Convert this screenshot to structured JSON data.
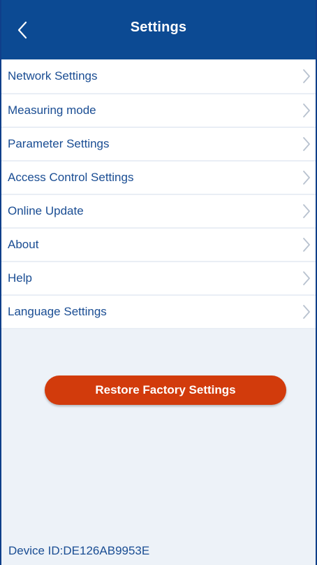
{
  "header": {
    "title": "Settings",
    "back_icon": "chevron-left-icon"
  },
  "menu": {
    "items": [
      {
        "label": "Network Settings"
      },
      {
        "label": "Measuring mode"
      },
      {
        "label": "Parameter Settings"
      },
      {
        "label": "Access Control Settings"
      },
      {
        "label": "Online Update"
      },
      {
        "label": "About"
      },
      {
        "label": "Help"
      },
      {
        "label": "Language Settings"
      }
    ],
    "chevron_icon": "chevron-right-icon"
  },
  "actions": {
    "restore_label": "Restore Factory Settings"
  },
  "footer": {
    "device_id": "Device ID:DE126AB9953E"
  },
  "colors": {
    "header_bg": "#0c4a93",
    "page_bg": "#edf2f8",
    "text_blue": "#1a4d93",
    "restore_button": "#d23b0c"
  }
}
